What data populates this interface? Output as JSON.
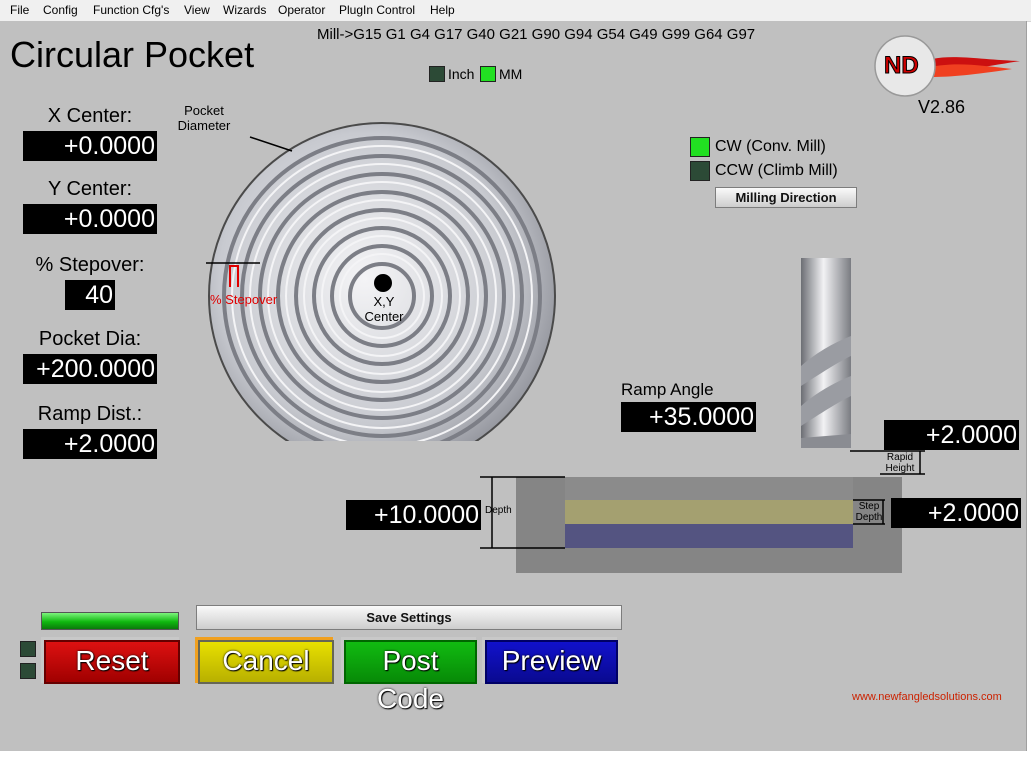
{
  "menu": [
    "File",
    "Config",
    "Function Cfg's",
    "View",
    "Wizards",
    "Operator",
    "PlugIn Control",
    "Help"
  ],
  "title": "Circular Pocket",
  "gcodes": "Mill->G15  G1 G4 G17 G40 G21 G90 G94 G54 G49 G99 G64 G97",
  "units": {
    "inch": "Inch",
    "mm": "MM",
    "inch_on": false,
    "mm_on": true
  },
  "logo": {
    "text": "ND",
    "version": "V2.86"
  },
  "fields": {
    "x_center": {
      "label": "X Center:",
      "value": "+0.0000"
    },
    "y_center": {
      "label": "Y Center:",
      "value": "+0.0000"
    },
    "stepover": {
      "label": "% Stepover:",
      "value": "40"
    },
    "pocket_dia": {
      "label": "Pocket Dia:",
      "value": "+200.0000"
    },
    "ramp_dist": {
      "label": "Ramp Dist.:",
      "value": "+2.0000"
    },
    "ramp_angle": {
      "label": "Ramp Angle",
      "value": "+35.0000"
    },
    "rapid_height": {
      "value": "+2.0000"
    },
    "depth": {
      "value": "+10.0000"
    },
    "step_depth": {
      "value": "+2.0000"
    }
  },
  "diagram": {
    "pocket_diameter_line1": "Pocket",
    "pocket_diameter_line2": "Diameter",
    "stepover_label": "% Stepover",
    "center_line1": "X,Y",
    "center_line2": "Center",
    "depth_label": "Depth",
    "step_depth_line1": "Step",
    "step_depth_line2": "Depth",
    "rapid_line1": "Rapid",
    "rapid_line2": "Height"
  },
  "direction": {
    "cw": "CW (Conv. Mill)",
    "ccw": "CCW (Climb Mill)",
    "cw_on": true,
    "ccw_on": false,
    "button": "Milling Direction"
  },
  "buttons": {
    "save": "Save Settings",
    "reset": "Reset",
    "cancel": "Cancel",
    "post": "Post Code",
    "preview": "Preview"
  },
  "progress": 1.0,
  "website": "www.newfangledsolutions.com",
  "colors": {
    "reset": "#dd1111",
    "cancel": "#e8e000",
    "post": "#11bb11",
    "preview": "#1111cc",
    "green_led": "#22e022",
    "website": "#cc2200",
    "stepover": "#e00000"
  }
}
